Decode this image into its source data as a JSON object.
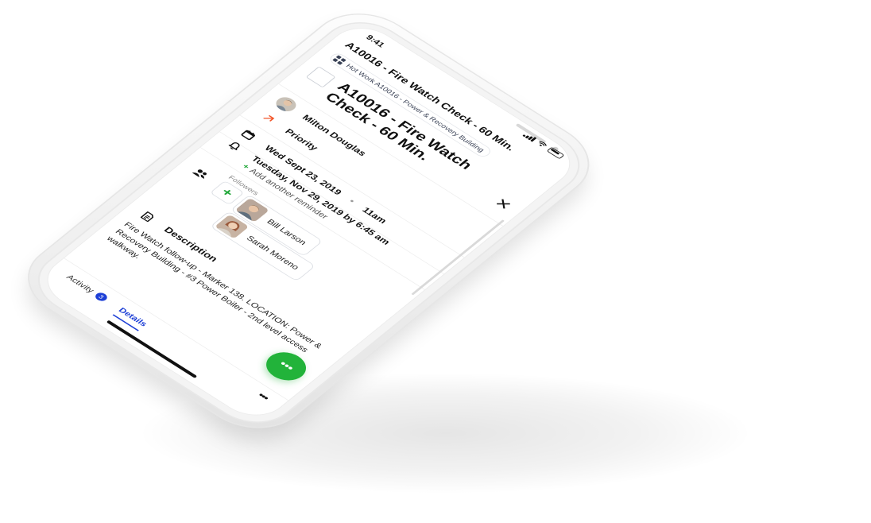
{
  "status_bar": {
    "time": "9:41"
  },
  "header": {
    "title": "A10016 - Fire Watch Check - 60 Min.",
    "close_glyph": "✕"
  },
  "breadcrumb": {
    "text": "Hot Work A10016 - Power & Recovery Building"
  },
  "task": {
    "title": "A10016 - Fire Watch Check - 60 Min."
  },
  "fields": {
    "assignee": "Milton Douglas",
    "priority": "Priority",
    "due_date": "Wed Sept 23, 2019",
    "reminder_date": "Tuesday, Nov 29, 2019 by 6:45 am",
    "reminder_time": "11am",
    "add_reminder": "Add another reminder"
  },
  "followers": {
    "label": "Followers",
    "add_glyph": "+",
    "people": [
      "Bill Larson",
      "Sarah Moreno"
    ]
  },
  "description": {
    "title": "Description",
    "body": "Fire Watch follow-up - Marker 138. LOCATION: Power & Recovery Building - #3 Power Boiler - 2nd level access walkway."
  },
  "fab": {
    "glyph": "•••"
  },
  "tabs": {
    "activity_label": "Activity",
    "activity_count": "3",
    "details_label": "Details",
    "more_glyph": "•••"
  },
  "colors": {
    "accent_blue": "#1d3fd6",
    "accent_green": "#22b33a",
    "priority_orange": "#f2572b"
  }
}
